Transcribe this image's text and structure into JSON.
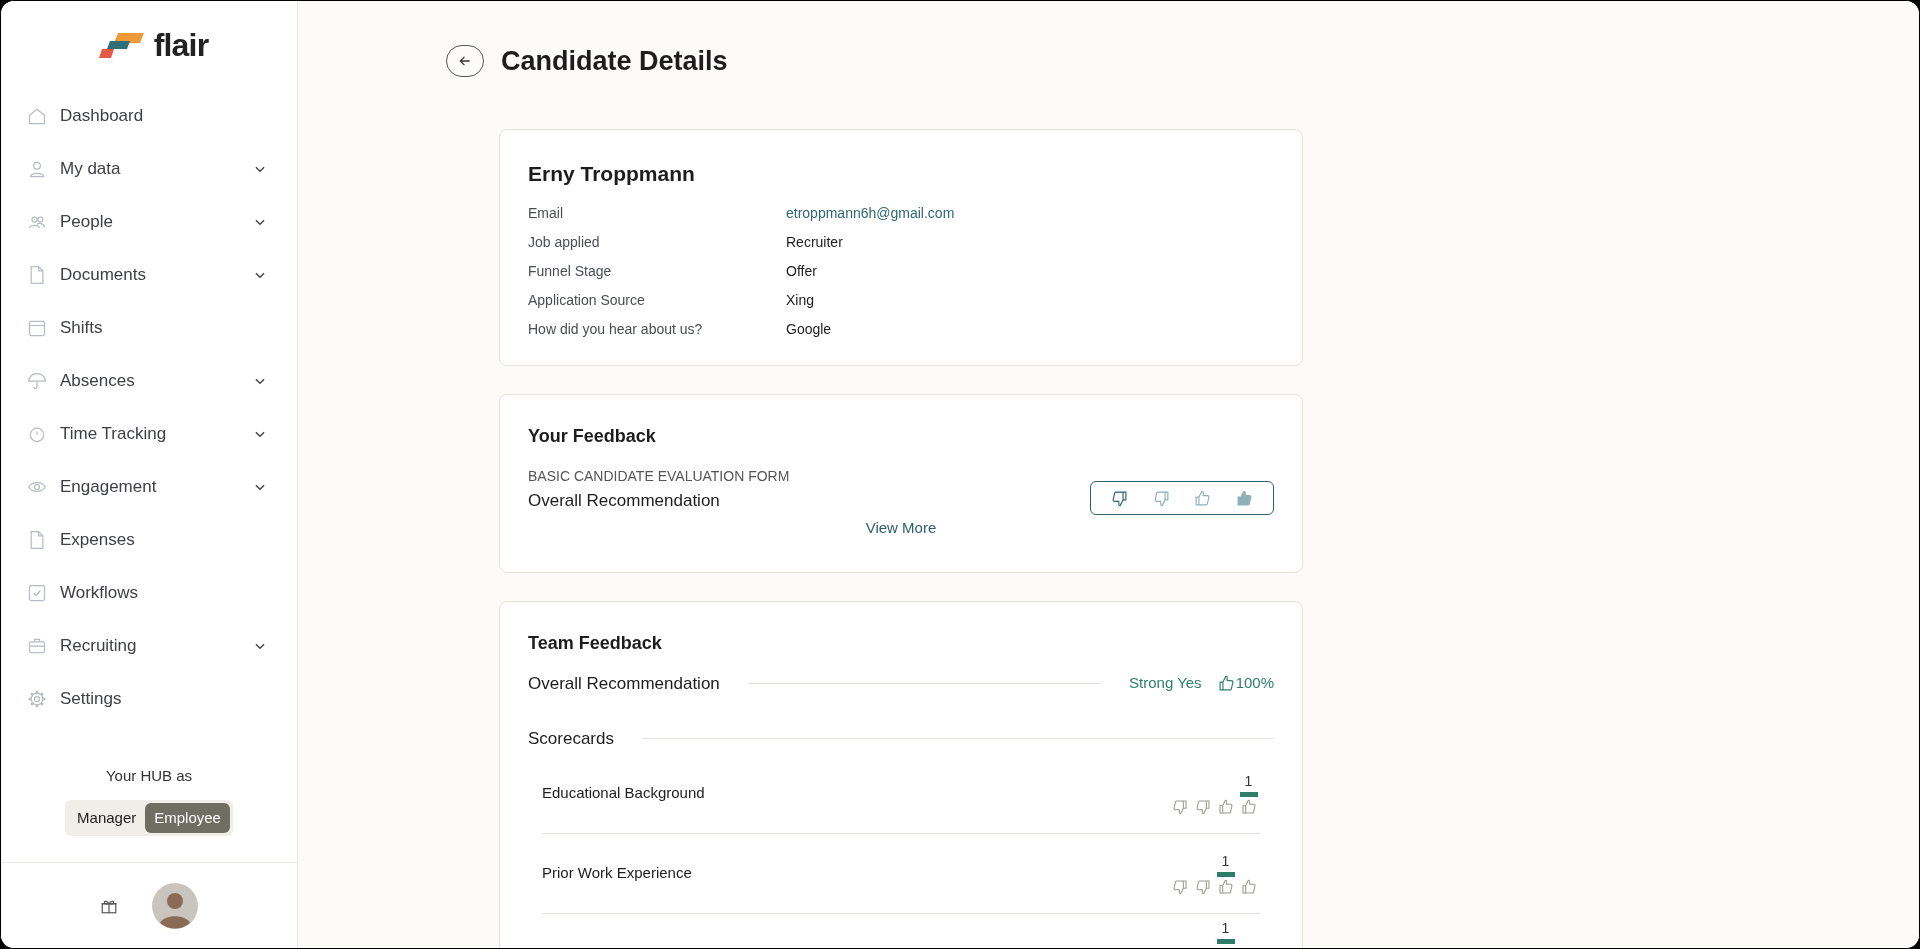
{
  "sidebar": {
    "logo": "flair",
    "items": [
      {
        "label": "Dashboard",
        "expandable": false
      },
      {
        "label": "My data",
        "expandable": true
      },
      {
        "label": "People",
        "expandable": true
      },
      {
        "label": "Documents",
        "expandable": true
      },
      {
        "label": "Shifts",
        "expandable": false
      },
      {
        "label": "Absences",
        "expandable": true
      },
      {
        "label": "Time Tracking",
        "expandable": true
      },
      {
        "label": "Engagement",
        "expandable": true
      },
      {
        "label": "Expenses",
        "expandable": false
      },
      {
        "label": "Workflows",
        "expandable": false
      },
      {
        "label": "Recruiting",
        "expandable": true
      },
      {
        "label": "Settings",
        "expandable": false
      }
    ],
    "hub_label": "Your HUB as",
    "hub_options": [
      {
        "label": "Manager",
        "selected": false
      },
      {
        "label": "Employee",
        "selected": true
      }
    ]
  },
  "page": {
    "title": "Candidate Details"
  },
  "candidate": {
    "name": "Erny Troppmann",
    "fields": [
      {
        "label": "Email",
        "value": "etroppmann6h@gmail.com",
        "kind": "link"
      },
      {
        "label": "Job applied",
        "value": "Recruiter",
        "kind": "text"
      },
      {
        "label": "Funnel Stage",
        "value": "Offer",
        "kind": "text"
      },
      {
        "label": "Application Source",
        "value": "Xing",
        "kind": "text"
      },
      {
        "label": "How did you hear about us?",
        "value": "Google",
        "kind": "text"
      }
    ]
  },
  "your_feedback": {
    "title": "Your Feedback",
    "form": "BASIC CANDIDATE EVALUATION FORM",
    "question": "Overall Recommendation",
    "link": "View More"
  },
  "team_feedback": {
    "title": "Team Feedback",
    "overall_label": "Overall Recommendation",
    "overall_value": "Strong Yes",
    "overall_percent": "100%",
    "scorecards_label": "Scorecards",
    "scorecards": [
      {
        "label": "Educational Background",
        "count": "1",
        "kind": "strongyes"
      },
      {
        "label": "Prior Work Experience",
        "count": "1",
        "kind": "yes"
      },
      {
        "count": "1",
        "kind": "yes"
      }
    ]
  }
}
